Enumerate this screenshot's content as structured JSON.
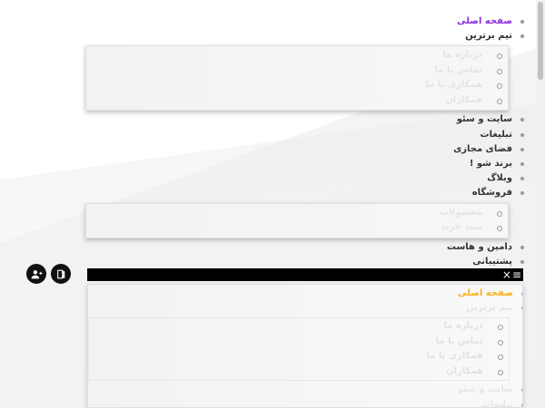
{
  "menu": {
    "items": [
      {
        "label": "صفحه اصلی"
      },
      {
        "label": "تیم برترین"
      },
      {
        "label": "سایت و سئو"
      },
      {
        "label": "تبلیغات"
      },
      {
        "label": "فضای مجازی"
      },
      {
        "label": "برند شو !"
      },
      {
        "label": "وبلاگ"
      },
      {
        "label": "فروشگاه"
      },
      {
        "label": "دامین و هاست"
      },
      {
        "label": "پشتیبانی"
      }
    ],
    "team_sub": [
      "درباره ما",
      "تماس با ما",
      "همکاری با ما",
      "همکاران"
    ],
    "shop_sub": [
      "محصولات",
      "سبد خرید"
    ]
  },
  "mobile_menu": {
    "close_glyph": "×",
    "hamburger_glyph": "≡",
    "items": [
      {
        "label": "صفحه اصلی"
      },
      {
        "label": "تیم برترین"
      },
      {
        "label": "سایت و سئو"
      },
      {
        "label": "تبلیغات"
      }
    ],
    "team_sub": [
      "درباره ما",
      "تماس با ما",
      "همکاری با ما",
      "همکاران"
    ]
  },
  "icons": {
    "login": "login-icon",
    "register": "add-user-icon"
  },
  "colors": {
    "active_primary": "#8e2be2",
    "active_mobile": "#f7b11a",
    "bar": "#000000"
  }
}
